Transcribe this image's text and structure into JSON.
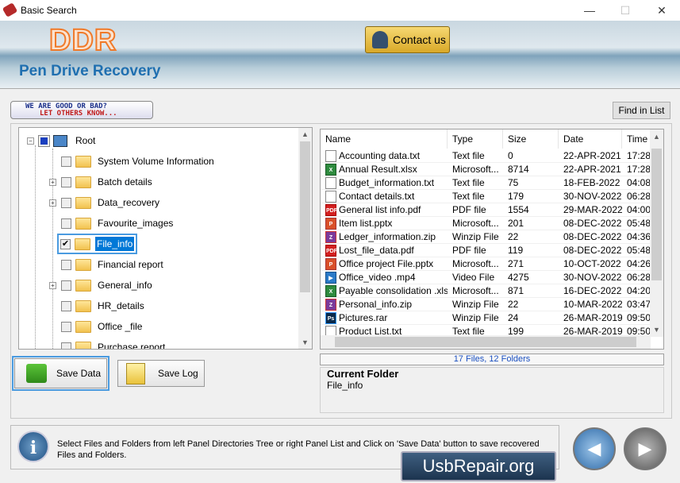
{
  "window": {
    "title": "Basic Search",
    "minimize": "—",
    "maximize": "☐",
    "close": "✕"
  },
  "header": {
    "logo": "DDR",
    "product": "Pen Drive Recovery",
    "contact_label": "Contact us"
  },
  "toolbar": {
    "rate_line1": "WE ARE GOOD OR BAD?",
    "rate_line2": "LET OTHERS KNOW...",
    "find_label": "Find in List"
  },
  "tree": {
    "root": "Root",
    "items": [
      {
        "label": "System Volume Information",
        "expandable": false,
        "checked": false
      },
      {
        "label": "Batch details",
        "expandable": true,
        "checked": false
      },
      {
        "label": "Data_recovery",
        "expandable": true,
        "checked": false
      },
      {
        "label": "Favourite_images",
        "expandable": false,
        "checked": false
      },
      {
        "label": "File_info",
        "expandable": false,
        "checked": true,
        "selected": true
      },
      {
        "label": "Financial report",
        "expandable": false,
        "checked": false
      },
      {
        "label": "General_info",
        "expandable": true,
        "checked": false
      },
      {
        "label": "HR_details",
        "expandable": false,
        "checked": false
      },
      {
        "label": "Office _file",
        "expandable": false,
        "checked": false
      },
      {
        "label": "Purchase report",
        "expandable": false,
        "checked": false
      }
    ]
  },
  "list": {
    "columns": [
      "Name",
      "Type",
      "Size",
      "Date",
      "Time"
    ],
    "rows": [
      {
        "icon": "txt",
        "name": "Accounting data.txt",
        "type": "Text file",
        "size": "0",
        "date": "22-APR-2021",
        "time": "17:28"
      },
      {
        "icon": "xlsx",
        "name": "Annual Result.xlsx",
        "type": "Microsoft...",
        "size": "8714",
        "date": "22-APR-2021",
        "time": "17:28"
      },
      {
        "icon": "txt",
        "name": "Budget_information.txt",
        "type": "Text file",
        "size": "75",
        "date": "18-FEB-2022",
        "time": "04:08"
      },
      {
        "icon": "txt",
        "name": "Contact details.txt",
        "type": "Text file",
        "size": "179",
        "date": "30-NOV-2022",
        "time": "06:28"
      },
      {
        "icon": "pdf",
        "name": "General list info.pdf",
        "type": "PDF file",
        "size": "1554",
        "date": "29-MAR-2022",
        "time": "04:00"
      },
      {
        "icon": "pptx",
        "name": "Item list.pptx",
        "type": "Microsoft...",
        "size": "201",
        "date": "08-DEC-2022",
        "time": "05:48"
      },
      {
        "icon": "zip",
        "name": "Ledger_information.zip",
        "type": "Winzip File",
        "size": "22",
        "date": "08-DEC-2022",
        "time": "04:36"
      },
      {
        "icon": "pdf",
        "name": "Lost_file_data.pdf",
        "type": "PDF file",
        "size": "119",
        "date": "08-DEC-2022",
        "time": "05:48"
      },
      {
        "icon": "pptx",
        "name": "Office project File.pptx",
        "type": "Microsoft...",
        "size": "271",
        "date": "10-OCT-2022",
        "time": "04:26"
      },
      {
        "icon": "video",
        "name": "Office_video .mp4",
        "type": "Video File",
        "size": "4275",
        "date": "30-NOV-2022",
        "time": "06:28"
      },
      {
        "icon": "xlsx",
        "name": "Payable consolidation .xlsx",
        "type": "Microsoft...",
        "size": "871",
        "date": "16-DEC-2022",
        "time": "04:20"
      },
      {
        "icon": "zip",
        "name": "Personal_info.zip",
        "type": "Winzip File",
        "size": "22",
        "date": "10-MAR-2022",
        "time": "03:47"
      },
      {
        "icon": "ps",
        "name": "Pictures.rar",
        "type": "Winzip File",
        "size": "24",
        "date": "26-MAR-2019",
        "time": "09:50"
      },
      {
        "icon": "txt",
        "name": "Product List.txt",
        "type": "Text file",
        "size": "199",
        "date": "26-MAR-2019",
        "time": "09:50"
      }
    ]
  },
  "status": {
    "count": "17 Files, 12 Folders"
  },
  "current_folder": {
    "heading": "Current Folder",
    "value": "File_info"
  },
  "buttons": {
    "save_data": "Save Data",
    "save_log": "Save Log"
  },
  "info": {
    "text": "Select Files and Folders from left Panel Directories Tree or right Panel List and Click on 'Save Data' button to save recovered Files and Folders."
  },
  "footer": {
    "brand": "UsbRepair.org"
  },
  "colors": {
    "accent": "#0078d7",
    "logo": "#f07a2a",
    "product": "#1f6fb0"
  }
}
